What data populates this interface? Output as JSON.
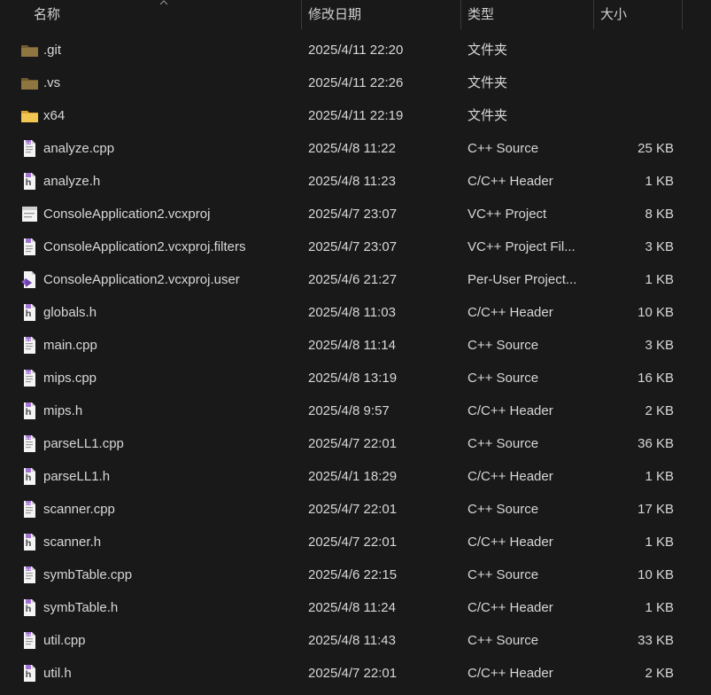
{
  "columns": {
    "name": "名称",
    "date": "修改日期",
    "type": "类型",
    "size": "大小"
  },
  "files": [
    {
      "name": ".git",
      "date": "2025/4/11 22:20",
      "type": "文件夹",
      "size": "",
      "icon": "folder-dark-icon"
    },
    {
      "name": ".vs",
      "date": "2025/4/11 22:26",
      "type": "文件夹",
      "size": "",
      "icon": "folder-dark-icon"
    },
    {
      "name": "x64",
      "date": "2025/4/11 22:19",
      "type": "文件夹",
      "size": "",
      "icon": "folder-icon"
    },
    {
      "name": "analyze.cpp",
      "date": "2025/4/8 11:22",
      "type": "C++ Source",
      "size": "25 KB",
      "icon": "cpp-file-icon"
    },
    {
      "name": "analyze.h",
      "date": "2025/4/8 11:23",
      "type": "C/C++ Header",
      "size": "1 KB",
      "icon": "header-file-icon"
    },
    {
      "name": "ConsoleApplication2.vcxproj",
      "date": "2025/4/7 23:07",
      "type": "VC++ Project",
      "size": "8 KB",
      "icon": "vcxproj-file-icon"
    },
    {
      "name": "ConsoleApplication2.vcxproj.filters",
      "date": "2025/4/7 23:07",
      "type": "VC++ Project Fil...",
      "size": "3 KB",
      "icon": "filters-file-icon"
    },
    {
      "name": "ConsoleApplication2.vcxproj.user",
      "date": "2025/4/6 21:27",
      "type": "Per-User Project...",
      "size": "1 KB",
      "icon": "user-file-icon"
    },
    {
      "name": "globals.h",
      "date": "2025/4/8 11:03",
      "type": "C/C++ Header",
      "size": "10 KB",
      "icon": "header-file-icon"
    },
    {
      "name": "main.cpp",
      "date": "2025/4/8 11:14",
      "type": "C++ Source",
      "size": "3 KB",
      "icon": "cpp-file-icon"
    },
    {
      "name": "mips.cpp",
      "date": "2025/4/8 13:19",
      "type": "C++ Source",
      "size": "16 KB",
      "icon": "cpp-file-icon"
    },
    {
      "name": "mips.h",
      "date": "2025/4/8 9:57",
      "type": "C/C++ Header",
      "size": "2 KB",
      "icon": "header-file-icon"
    },
    {
      "name": "parseLL1.cpp",
      "date": "2025/4/7 22:01",
      "type": "C++ Source",
      "size": "36 KB",
      "icon": "cpp-file-icon"
    },
    {
      "name": "parseLL1.h",
      "date": "2025/4/1 18:29",
      "type": "C/C++ Header",
      "size": "1 KB",
      "icon": "header-file-icon"
    },
    {
      "name": "scanner.cpp",
      "date": "2025/4/7 22:01",
      "type": "C++ Source",
      "size": "17 KB",
      "icon": "cpp-file-icon"
    },
    {
      "name": "scanner.h",
      "date": "2025/4/7 22:01",
      "type": "C/C++ Header",
      "size": "1 KB",
      "icon": "header-file-icon"
    },
    {
      "name": "symbTable.cpp",
      "date": "2025/4/6 22:15",
      "type": "C++ Source",
      "size": "10 KB",
      "icon": "cpp-file-icon"
    },
    {
      "name": "symbTable.h",
      "date": "2025/4/8 11:24",
      "type": "C/C++ Header",
      "size": "1 KB",
      "icon": "header-file-icon"
    },
    {
      "name": "util.cpp",
      "date": "2025/4/8 11:43",
      "type": "C++ Source",
      "size": "33 KB",
      "icon": "cpp-file-icon"
    },
    {
      "name": "util.h",
      "date": "2025/4/7 22:01",
      "type": "C/C++ Header",
      "size": "2 KB",
      "icon": "header-file-icon"
    }
  ],
  "colors": {
    "background": "#191919",
    "text": "#d7d7d7",
    "folder": "#e8b84a",
    "folder_dark": "#8a7340",
    "cpp_accent": "#a374d5"
  }
}
